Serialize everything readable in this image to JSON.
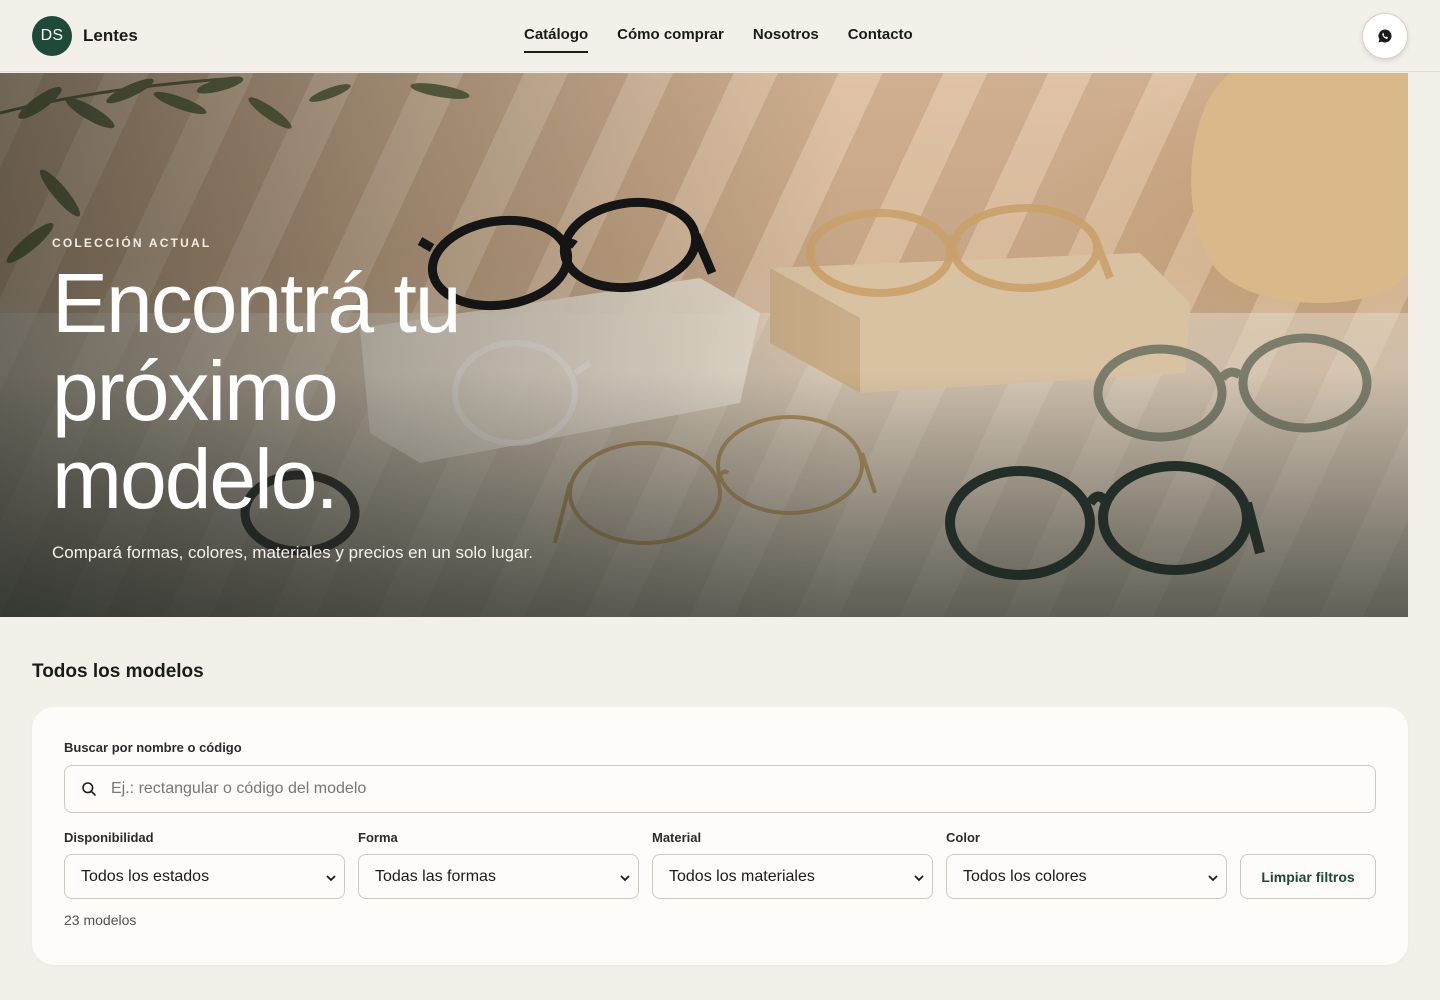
{
  "header": {
    "brand_initials": "DS",
    "brand_name": "Lentes",
    "nav": [
      {
        "label": "Catálogo",
        "active": true
      },
      {
        "label": "Cómo comprar",
        "active": false
      },
      {
        "label": "Nosotros",
        "active": false
      },
      {
        "label": "Contacto",
        "active": false
      }
    ],
    "contact_icon": "whatsapp-icon"
  },
  "hero": {
    "eyebrow": "COLECCIÓN ACTUAL",
    "title": "Encontrá tu próximo modelo.",
    "subtitle": "Compará formas, colores, materiales y precios en un solo lugar."
  },
  "models": {
    "title": "Todos los modelos",
    "search": {
      "label": "Buscar por nombre o código",
      "placeholder": "Ej.: rectangular o código del modelo",
      "value": ""
    },
    "filters": [
      {
        "label": "Disponibilidad",
        "value": "Todos los estados"
      },
      {
        "label": "Forma",
        "value": "Todas las formas"
      },
      {
        "label": "Material",
        "value": "Todos los materiales"
      },
      {
        "label": "Color",
        "value": "Todos los colores"
      }
    ],
    "clear_label": "Limpiar filtros",
    "count": "23 modelos"
  },
  "colors": {
    "brand_green": "#1f4a3a",
    "background": "#f3f0ea",
    "card": "#fdfcf9"
  }
}
